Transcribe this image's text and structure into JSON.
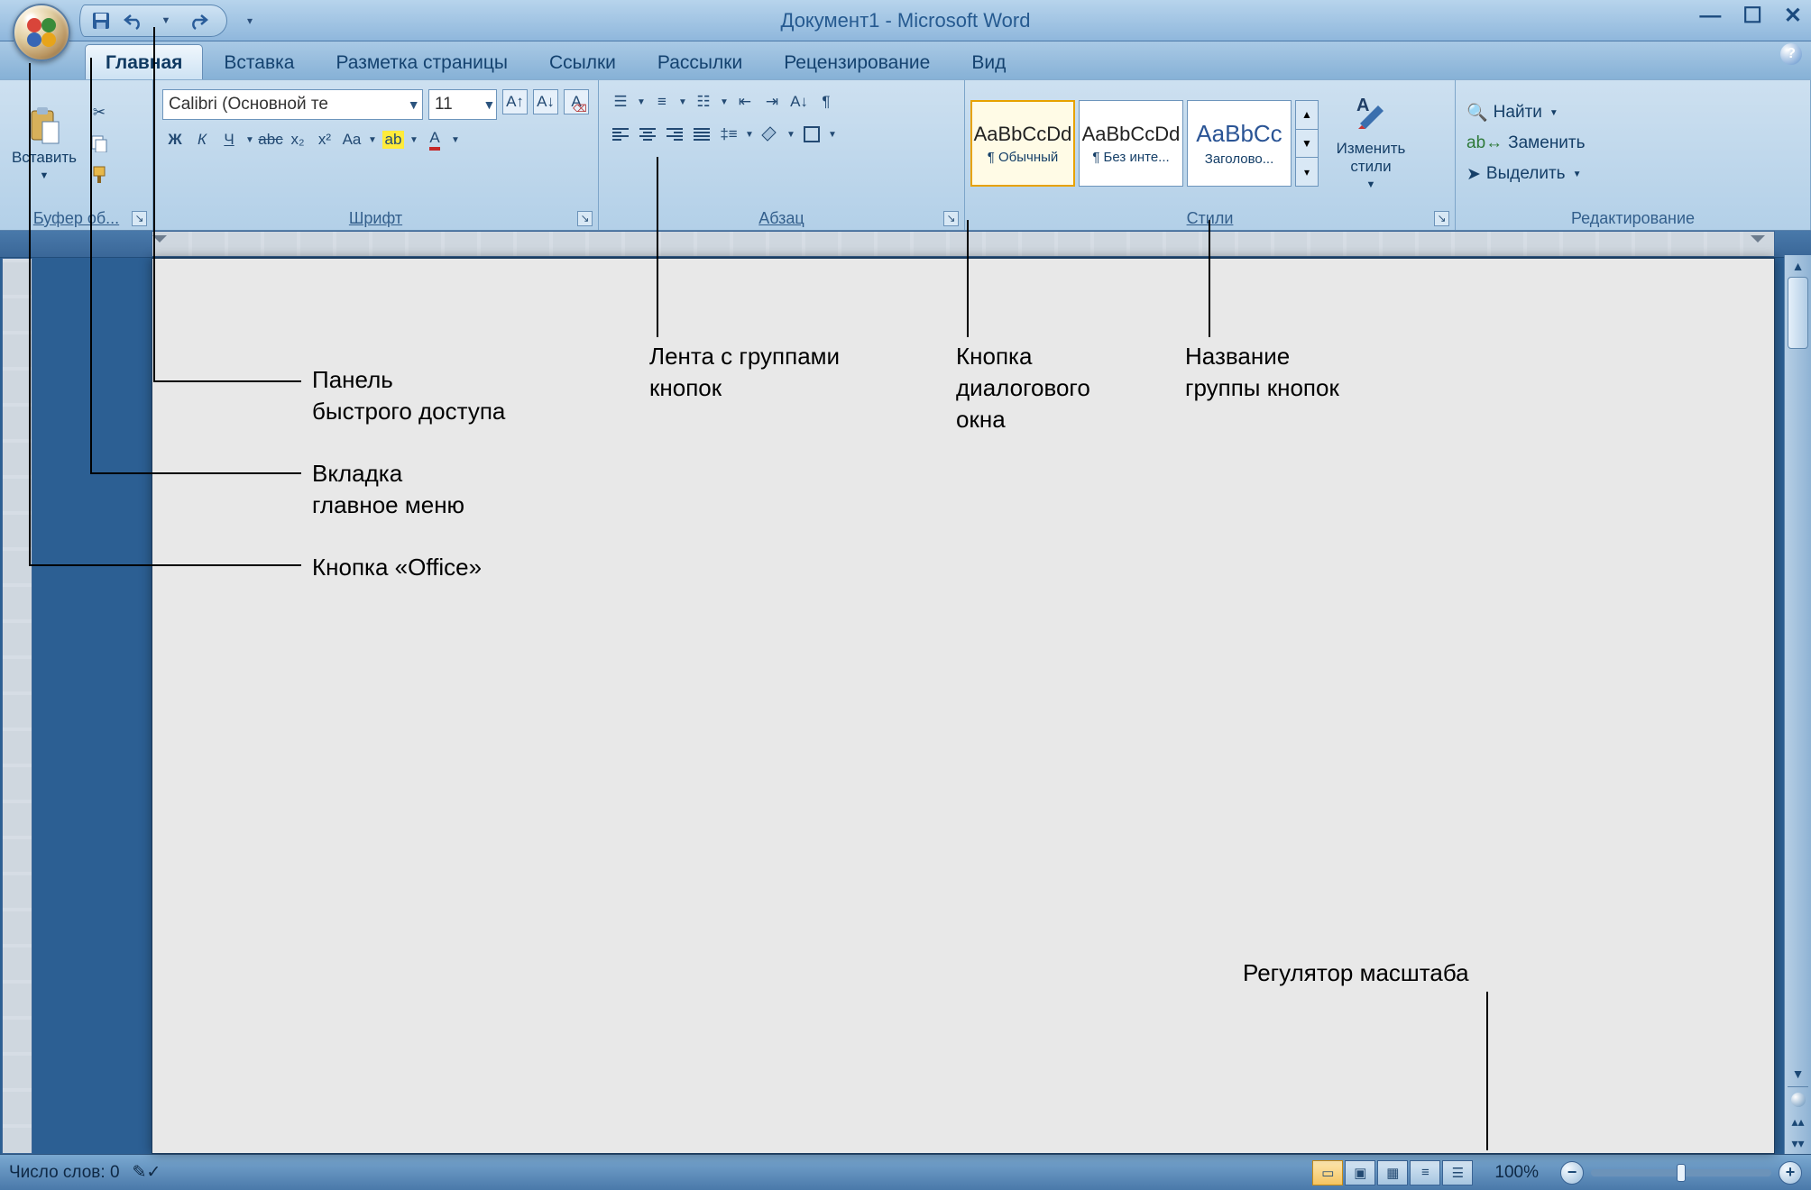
{
  "title_bar": {
    "title": "Документ1 - Microsoft Word"
  },
  "tabs": {
    "items": [
      "Главная",
      "Вставка",
      "Разметка страницы",
      "Ссылки",
      "Рассылки",
      "Рецензирование",
      "Вид"
    ],
    "active_index": 0
  },
  "ribbon": {
    "clipboard": {
      "paste": "Вставить",
      "label": "Буфер об..."
    },
    "font": {
      "label": "Шрифт",
      "name": "Calibri (Основной те",
      "size": "11",
      "bold": "Ж",
      "italic": "К",
      "underline": "Ч",
      "strike": "abc",
      "sub": "x₂",
      "sup": "x²",
      "case": "Aa",
      "clear": "A"
    },
    "paragraph": {
      "label": "Абзац"
    },
    "styles": {
      "label": "Стили",
      "items": [
        {
          "sample": "AaBbCcDd",
          "name": "¶ Обычный",
          "selected": true
        },
        {
          "sample": "AaBbCcDd",
          "name": "¶ Без инте..."
        },
        {
          "sample": "AaBbCc",
          "name": "Заголово..."
        }
      ],
      "change": "Изменить\nстили"
    },
    "editing": {
      "label": "Редактирование",
      "find": "Найти",
      "replace": "Заменить",
      "select": "Выделить"
    }
  },
  "annotations": {
    "qat": "Панель\nбыстрого доступа",
    "tab": "Вкладка\nглавное меню",
    "office": "Кнопка «Office»",
    "ribbon_strip": "Лента с группами\nкнопок",
    "dialog": "Кнопка\nдиалогового\nокна",
    "group_name": "Название\nгруппы кнопок",
    "zoom": "Регулятор масштаба"
  },
  "status": {
    "words": "Число слов: 0",
    "zoom": "100%"
  }
}
